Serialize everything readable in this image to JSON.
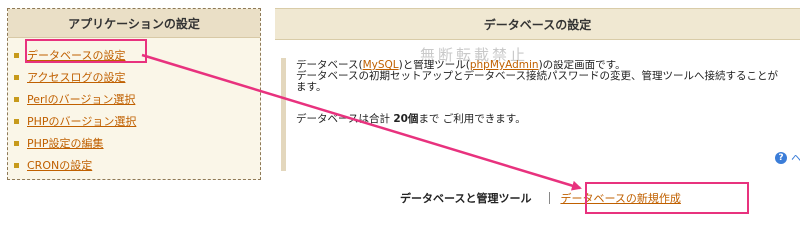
{
  "sidebar": {
    "title": "アプリケーションの設定",
    "items": [
      {
        "label": "データベースの設定"
      },
      {
        "label": "アクセスログの設定"
      },
      {
        "label": "Perlのバージョン選択"
      },
      {
        "label": "PHPのバージョン選択"
      },
      {
        "label": "PHP設定の編集"
      },
      {
        "label": "CRONの設定"
      }
    ]
  },
  "main": {
    "title": "データベースの設定",
    "line1_a": "データベース(",
    "mysql": "MySQL",
    "line1_b": ")と管理ツール(",
    "phpmyadmin": "phpMyAdmin",
    "line1_c": ")の設定画面です。",
    "line2": "データベースの初期セットアップとデータベース接続パスワードの変更、管理ツールへ接続することが",
    "line3": "ます。",
    "limit_a": "データベースは合計 ",
    "limit_count": "20個",
    "limit_b": "まで ご利用できます。",
    "help_trail": "ヘ"
  },
  "tabs": {
    "active": "データベースと管理ツール",
    "link": "データベースの新規作成"
  },
  "watermark": "無断転載禁止",
  "colors": {
    "highlight": "#e8327e",
    "link": "#c06000",
    "bullet": "#c79a1b"
  }
}
